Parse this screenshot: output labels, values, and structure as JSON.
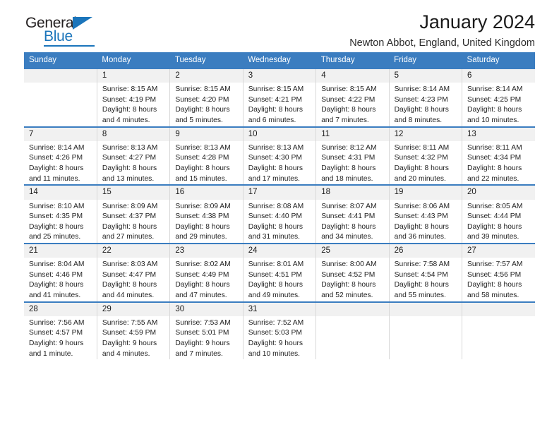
{
  "brand": {
    "name_top": "General",
    "name_bottom": "Blue",
    "accent_color": "#1b75bb"
  },
  "header": {
    "title": "January 2024",
    "subtitle": "Newton Abbot, England, United Kingdom",
    "header_bg": "#3b7dc0",
    "daycell_header_bg": "#f1f1f1"
  },
  "weekdays": [
    "Sunday",
    "Monday",
    "Tuesday",
    "Wednesday",
    "Thursday",
    "Friday",
    "Saturday"
  ],
  "weeks": [
    [
      {
        "date": "",
        "sunrise": "",
        "sunset": "",
        "daylight_line1": "",
        "daylight_line2": ""
      },
      {
        "date": "1",
        "sunrise": "Sunrise: 8:15 AM",
        "sunset": "Sunset: 4:19 PM",
        "daylight_line1": "Daylight: 8 hours",
        "daylight_line2": "and 4 minutes."
      },
      {
        "date": "2",
        "sunrise": "Sunrise: 8:15 AM",
        "sunset": "Sunset: 4:20 PM",
        "daylight_line1": "Daylight: 8 hours",
        "daylight_line2": "and 5 minutes."
      },
      {
        "date": "3",
        "sunrise": "Sunrise: 8:15 AM",
        "sunset": "Sunset: 4:21 PM",
        "daylight_line1": "Daylight: 8 hours",
        "daylight_line2": "and 6 minutes."
      },
      {
        "date": "4",
        "sunrise": "Sunrise: 8:15 AM",
        "sunset": "Sunset: 4:22 PM",
        "daylight_line1": "Daylight: 8 hours",
        "daylight_line2": "and 7 minutes."
      },
      {
        "date": "5",
        "sunrise": "Sunrise: 8:14 AM",
        "sunset": "Sunset: 4:23 PM",
        "daylight_line1": "Daylight: 8 hours",
        "daylight_line2": "and 8 minutes."
      },
      {
        "date": "6",
        "sunrise": "Sunrise: 8:14 AM",
        "sunset": "Sunset: 4:25 PM",
        "daylight_line1": "Daylight: 8 hours",
        "daylight_line2": "and 10 minutes."
      }
    ],
    [
      {
        "date": "7",
        "sunrise": "Sunrise: 8:14 AM",
        "sunset": "Sunset: 4:26 PM",
        "daylight_line1": "Daylight: 8 hours",
        "daylight_line2": "and 11 minutes."
      },
      {
        "date": "8",
        "sunrise": "Sunrise: 8:13 AM",
        "sunset": "Sunset: 4:27 PM",
        "daylight_line1": "Daylight: 8 hours",
        "daylight_line2": "and 13 minutes."
      },
      {
        "date": "9",
        "sunrise": "Sunrise: 8:13 AM",
        "sunset": "Sunset: 4:28 PM",
        "daylight_line1": "Daylight: 8 hours",
        "daylight_line2": "and 15 minutes."
      },
      {
        "date": "10",
        "sunrise": "Sunrise: 8:13 AM",
        "sunset": "Sunset: 4:30 PM",
        "daylight_line1": "Daylight: 8 hours",
        "daylight_line2": "and 17 minutes."
      },
      {
        "date": "11",
        "sunrise": "Sunrise: 8:12 AM",
        "sunset": "Sunset: 4:31 PM",
        "daylight_line1": "Daylight: 8 hours",
        "daylight_line2": "and 18 minutes."
      },
      {
        "date": "12",
        "sunrise": "Sunrise: 8:11 AM",
        "sunset": "Sunset: 4:32 PM",
        "daylight_line1": "Daylight: 8 hours",
        "daylight_line2": "and 20 minutes."
      },
      {
        "date": "13",
        "sunrise": "Sunrise: 8:11 AM",
        "sunset": "Sunset: 4:34 PM",
        "daylight_line1": "Daylight: 8 hours",
        "daylight_line2": "and 22 minutes."
      }
    ],
    [
      {
        "date": "14",
        "sunrise": "Sunrise: 8:10 AM",
        "sunset": "Sunset: 4:35 PM",
        "daylight_line1": "Daylight: 8 hours",
        "daylight_line2": "and 25 minutes."
      },
      {
        "date": "15",
        "sunrise": "Sunrise: 8:09 AM",
        "sunset": "Sunset: 4:37 PM",
        "daylight_line1": "Daylight: 8 hours",
        "daylight_line2": "and 27 minutes."
      },
      {
        "date": "16",
        "sunrise": "Sunrise: 8:09 AM",
        "sunset": "Sunset: 4:38 PM",
        "daylight_line1": "Daylight: 8 hours",
        "daylight_line2": "and 29 minutes."
      },
      {
        "date": "17",
        "sunrise": "Sunrise: 8:08 AM",
        "sunset": "Sunset: 4:40 PM",
        "daylight_line1": "Daylight: 8 hours",
        "daylight_line2": "and 31 minutes."
      },
      {
        "date": "18",
        "sunrise": "Sunrise: 8:07 AM",
        "sunset": "Sunset: 4:41 PM",
        "daylight_line1": "Daylight: 8 hours",
        "daylight_line2": "and 34 minutes."
      },
      {
        "date": "19",
        "sunrise": "Sunrise: 8:06 AM",
        "sunset": "Sunset: 4:43 PM",
        "daylight_line1": "Daylight: 8 hours",
        "daylight_line2": "and 36 minutes."
      },
      {
        "date": "20",
        "sunrise": "Sunrise: 8:05 AM",
        "sunset": "Sunset: 4:44 PM",
        "daylight_line1": "Daylight: 8 hours",
        "daylight_line2": "and 39 minutes."
      }
    ],
    [
      {
        "date": "21",
        "sunrise": "Sunrise: 8:04 AM",
        "sunset": "Sunset: 4:46 PM",
        "daylight_line1": "Daylight: 8 hours",
        "daylight_line2": "and 41 minutes."
      },
      {
        "date": "22",
        "sunrise": "Sunrise: 8:03 AM",
        "sunset": "Sunset: 4:47 PM",
        "daylight_line1": "Daylight: 8 hours",
        "daylight_line2": "and 44 minutes."
      },
      {
        "date": "23",
        "sunrise": "Sunrise: 8:02 AM",
        "sunset": "Sunset: 4:49 PM",
        "daylight_line1": "Daylight: 8 hours",
        "daylight_line2": "and 47 minutes."
      },
      {
        "date": "24",
        "sunrise": "Sunrise: 8:01 AM",
        "sunset": "Sunset: 4:51 PM",
        "daylight_line1": "Daylight: 8 hours",
        "daylight_line2": "and 49 minutes."
      },
      {
        "date": "25",
        "sunrise": "Sunrise: 8:00 AM",
        "sunset": "Sunset: 4:52 PM",
        "daylight_line1": "Daylight: 8 hours",
        "daylight_line2": "and 52 minutes."
      },
      {
        "date": "26",
        "sunrise": "Sunrise: 7:58 AM",
        "sunset": "Sunset: 4:54 PM",
        "daylight_line1": "Daylight: 8 hours",
        "daylight_line2": "and 55 minutes."
      },
      {
        "date": "27",
        "sunrise": "Sunrise: 7:57 AM",
        "sunset": "Sunset: 4:56 PM",
        "daylight_line1": "Daylight: 8 hours",
        "daylight_line2": "and 58 minutes."
      }
    ],
    [
      {
        "date": "28",
        "sunrise": "Sunrise: 7:56 AM",
        "sunset": "Sunset: 4:57 PM",
        "daylight_line1": "Daylight: 9 hours",
        "daylight_line2": "and 1 minute."
      },
      {
        "date": "29",
        "sunrise": "Sunrise: 7:55 AM",
        "sunset": "Sunset: 4:59 PM",
        "daylight_line1": "Daylight: 9 hours",
        "daylight_line2": "and 4 minutes."
      },
      {
        "date": "30",
        "sunrise": "Sunrise: 7:53 AM",
        "sunset": "Sunset: 5:01 PM",
        "daylight_line1": "Daylight: 9 hours",
        "daylight_line2": "and 7 minutes."
      },
      {
        "date": "31",
        "sunrise": "Sunrise: 7:52 AM",
        "sunset": "Sunset: 5:03 PM",
        "daylight_line1": "Daylight: 9 hours",
        "daylight_line2": "and 10 minutes."
      },
      {
        "date": "",
        "sunrise": "",
        "sunset": "",
        "daylight_line1": "",
        "daylight_line2": ""
      },
      {
        "date": "",
        "sunrise": "",
        "sunset": "",
        "daylight_line1": "",
        "daylight_line2": ""
      },
      {
        "date": "",
        "sunrise": "",
        "sunset": "",
        "daylight_line1": "",
        "daylight_line2": ""
      }
    ]
  ]
}
